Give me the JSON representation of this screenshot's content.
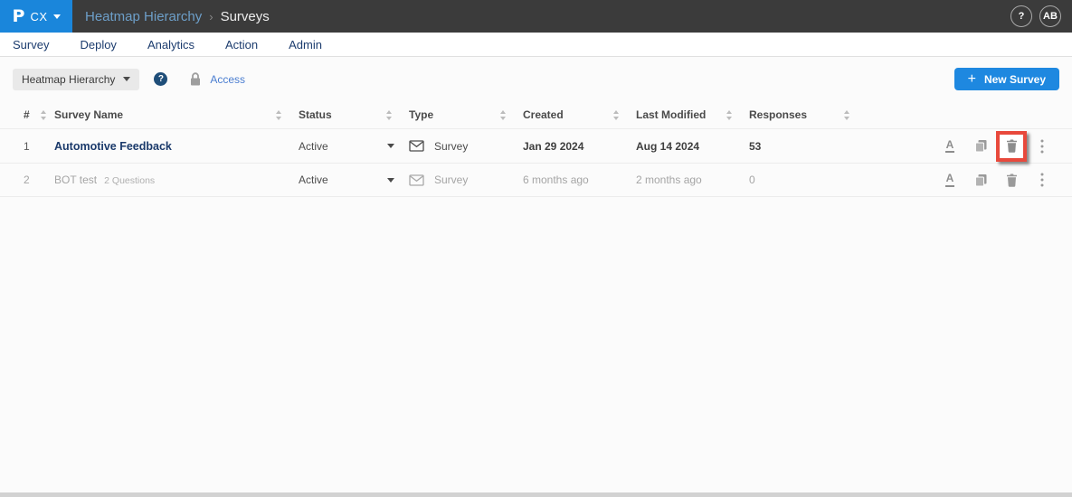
{
  "topbar": {
    "logo_mark": "P",
    "logo_product": "CX",
    "breadcrumb_parent": "Heatmap Hierarchy",
    "breadcrumb_separator": "›",
    "breadcrumb_current": "Surveys",
    "help": "?",
    "avatar": "AB"
  },
  "nav": {
    "items": [
      "Survey",
      "Deploy",
      "Analytics",
      "Action",
      "Admin"
    ]
  },
  "toolbar": {
    "hierarchy_selector": "Heatmap Hierarchy",
    "help_badge": "?",
    "access_link": "Access",
    "new_survey": {
      "plus": "+",
      "label": "New Survey"
    }
  },
  "table": {
    "headers": {
      "index": "#",
      "name": "Survey Name",
      "status": "Status",
      "type": "Type",
      "created": "Created",
      "modified": "Last Modified",
      "responses": "Responses"
    },
    "rows": [
      {
        "index": "1",
        "name": "Automotive Feedback",
        "questions": "",
        "status": "Active",
        "type": "Survey",
        "created": "Jan 29 2024",
        "modified": "Aug 14 2024",
        "responses": "53"
      },
      {
        "index": "2",
        "name": "BOT test",
        "questions": "2 Questions",
        "status": "Active",
        "type": "Survey",
        "created": "6 months ago",
        "modified": "2 months ago",
        "responses": "0"
      }
    ]
  },
  "colors": {
    "topbar_bg": "#3b3b3b",
    "logo_blue": "#1a86db",
    "accent_blue": "#1e88e0",
    "nav_link": "#1c3c6e",
    "link_blue": "#4a7dd0",
    "name_link": "#1b3a6b",
    "highlight_red": "#e8493c",
    "muted_text": "#a5a5a5"
  }
}
